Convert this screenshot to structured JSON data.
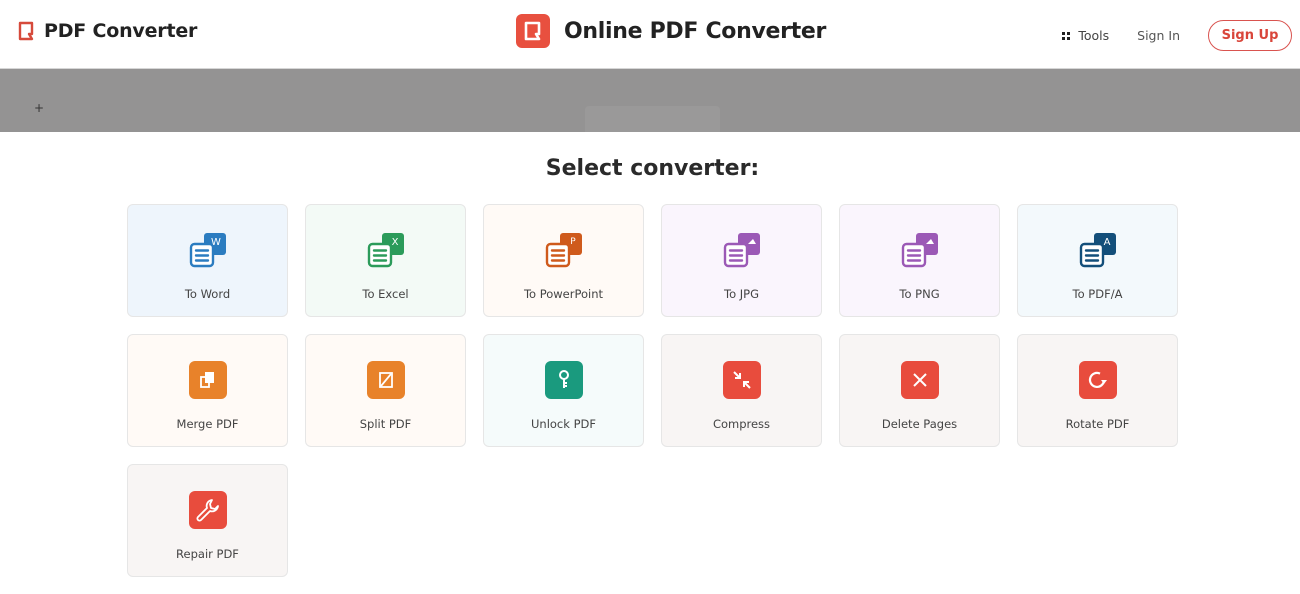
{
  "header": {
    "brand_left": "PDF Converter",
    "brand_center": "Online PDF Converter",
    "nav": {
      "tools_label": "Tools",
      "signin_label": "Sign In",
      "signup_label": "Sign Up"
    }
  },
  "overlay": {
    "plus_glyph": "+"
  },
  "main": {
    "title": "Select converter:",
    "converters": [
      {
        "label": "To Word",
        "icon": "word-icon",
        "color": "#2b7cc0",
        "bg": "#eef5fc"
      },
      {
        "label": "To Excel",
        "icon": "excel-icon",
        "color": "#2b9b5a",
        "bg": "#f3faf6"
      },
      {
        "label": "To PowerPoint",
        "icon": "powerpoint-icon",
        "color": "#cf5a1c",
        "bg": "#fffaf6"
      },
      {
        "label": "To JPG",
        "icon": "jpg-icon",
        "color": "#9b59b6",
        "bg": "#faf5fd"
      },
      {
        "label": "To PNG",
        "icon": "png-icon",
        "color": "#9b59b6",
        "bg": "#faf5fd"
      },
      {
        "label": "To PDF/A",
        "icon": "pdfa-icon",
        "color": "#134f7a",
        "bg": "#f3f9fc"
      },
      {
        "label": "Merge PDF",
        "icon": "merge-icon",
        "color": "#e8822a",
        "bg": "#fffaf6"
      },
      {
        "label": "Split PDF",
        "icon": "split-icon",
        "color": "#e8822a",
        "bg": "#fffaf6"
      },
      {
        "label": "Unlock PDF",
        "icon": "key-icon",
        "color": "#1a9a7e",
        "bg": "#f5fbfb"
      },
      {
        "label": "Compress",
        "icon": "compress-icon",
        "color": "#e84c3d",
        "bg": "#f8f5f4"
      },
      {
        "label": "Delete Pages",
        "icon": "delete-icon",
        "color": "#e84c3d",
        "bg": "#f8f5f4"
      },
      {
        "label": "Rotate PDF",
        "icon": "rotate-icon",
        "color": "#e84c3d",
        "bg": "#f8f5f4"
      },
      {
        "label": "Repair PDF",
        "icon": "wrench-icon",
        "color": "#e84c3d",
        "bg": "#f8f5f4"
      }
    ]
  }
}
